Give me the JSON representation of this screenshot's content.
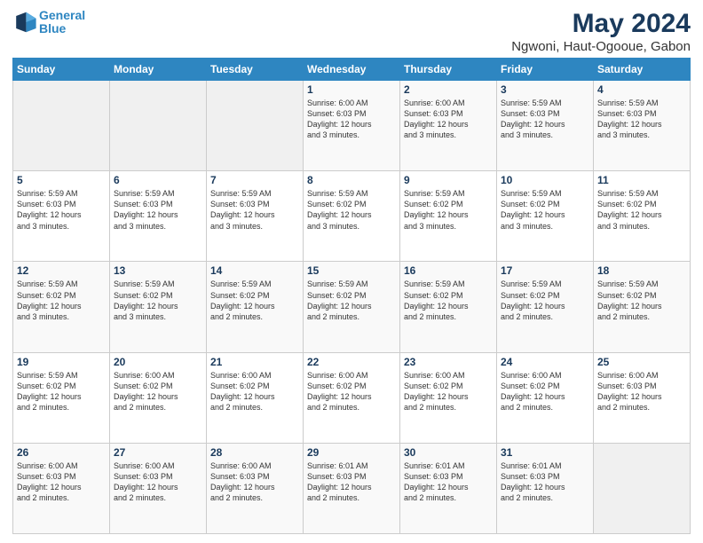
{
  "logo": {
    "line1": "General",
    "line2": "Blue"
  },
  "title": "May 2024",
  "subtitle": "Ngwoni, Haut-Ogooue, Gabon",
  "days_header": [
    "Sunday",
    "Monday",
    "Tuesday",
    "Wednesday",
    "Thursday",
    "Friday",
    "Saturday"
  ],
  "weeks": [
    [
      {
        "day": "",
        "info": ""
      },
      {
        "day": "",
        "info": ""
      },
      {
        "day": "",
        "info": ""
      },
      {
        "day": "1",
        "info": "Sunrise: 6:00 AM\nSunset: 6:03 PM\nDaylight: 12 hours\nand 3 minutes."
      },
      {
        "day": "2",
        "info": "Sunrise: 6:00 AM\nSunset: 6:03 PM\nDaylight: 12 hours\nand 3 minutes."
      },
      {
        "day": "3",
        "info": "Sunrise: 5:59 AM\nSunset: 6:03 PM\nDaylight: 12 hours\nand 3 minutes."
      },
      {
        "day": "4",
        "info": "Sunrise: 5:59 AM\nSunset: 6:03 PM\nDaylight: 12 hours\nand 3 minutes."
      }
    ],
    [
      {
        "day": "5",
        "info": "Sunrise: 5:59 AM\nSunset: 6:03 PM\nDaylight: 12 hours\nand 3 minutes."
      },
      {
        "day": "6",
        "info": "Sunrise: 5:59 AM\nSunset: 6:03 PM\nDaylight: 12 hours\nand 3 minutes."
      },
      {
        "day": "7",
        "info": "Sunrise: 5:59 AM\nSunset: 6:03 PM\nDaylight: 12 hours\nand 3 minutes."
      },
      {
        "day": "8",
        "info": "Sunrise: 5:59 AM\nSunset: 6:02 PM\nDaylight: 12 hours\nand 3 minutes."
      },
      {
        "day": "9",
        "info": "Sunrise: 5:59 AM\nSunset: 6:02 PM\nDaylight: 12 hours\nand 3 minutes."
      },
      {
        "day": "10",
        "info": "Sunrise: 5:59 AM\nSunset: 6:02 PM\nDaylight: 12 hours\nand 3 minutes."
      },
      {
        "day": "11",
        "info": "Sunrise: 5:59 AM\nSunset: 6:02 PM\nDaylight: 12 hours\nand 3 minutes."
      }
    ],
    [
      {
        "day": "12",
        "info": "Sunrise: 5:59 AM\nSunset: 6:02 PM\nDaylight: 12 hours\nand 3 minutes."
      },
      {
        "day": "13",
        "info": "Sunrise: 5:59 AM\nSunset: 6:02 PM\nDaylight: 12 hours\nand 3 minutes."
      },
      {
        "day": "14",
        "info": "Sunrise: 5:59 AM\nSunset: 6:02 PM\nDaylight: 12 hours\nand 2 minutes."
      },
      {
        "day": "15",
        "info": "Sunrise: 5:59 AM\nSunset: 6:02 PM\nDaylight: 12 hours\nand 2 minutes."
      },
      {
        "day": "16",
        "info": "Sunrise: 5:59 AM\nSunset: 6:02 PM\nDaylight: 12 hours\nand 2 minutes."
      },
      {
        "day": "17",
        "info": "Sunrise: 5:59 AM\nSunset: 6:02 PM\nDaylight: 12 hours\nand 2 minutes."
      },
      {
        "day": "18",
        "info": "Sunrise: 5:59 AM\nSunset: 6:02 PM\nDaylight: 12 hours\nand 2 minutes."
      }
    ],
    [
      {
        "day": "19",
        "info": "Sunrise: 5:59 AM\nSunset: 6:02 PM\nDaylight: 12 hours\nand 2 minutes."
      },
      {
        "day": "20",
        "info": "Sunrise: 6:00 AM\nSunset: 6:02 PM\nDaylight: 12 hours\nand 2 minutes."
      },
      {
        "day": "21",
        "info": "Sunrise: 6:00 AM\nSunset: 6:02 PM\nDaylight: 12 hours\nand 2 minutes."
      },
      {
        "day": "22",
        "info": "Sunrise: 6:00 AM\nSunset: 6:02 PM\nDaylight: 12 hours\nand 2 minutes."
      },
      {
        "day": "23",
        "info": "Sunrise: 6:00 AM\nSunset: 6:02 PM\nDaylight: 12 hours\nand 2 minutes."
      },
      {
        "day": "24",
        "info": "Sunrise: 6:00 AM\nSunset: 6:02 PM\nDaylight: 12 hours\nand 2 minutes."
      },
      {
        "day": "25",
        "info": "Sunrise: 6:00 AM\nSunset: 6:03 PM\nDaylight: 12 hours\nand 2 minutes."
      }
    ],
    [
      {
        "day": "26",
        "info": "Sunrise: 6:00 AM\nSunset: 6:03 PM\nDaylight: 12 hours\nand 2 minutes."
      },
      {
        "day": "27",
        "info": "Sunrise: 6:00 AM\nSunset: 6:03 PM\nDaylight: 12 hours\nand 2 minutes."
      },
      {
        "day": "28",
        "info": "Sunrise: 6:00 AM\nSunset: 6:03 PM\nDaylight: 12 hours\nand 2 minutes."
      },
      {
        "day": "29",
        "info": "Sunrise: 6:01 AM\nSunset: 6:03 PM\nDaylight: 12 hours\nand 2 minutes."
      },
      {
        "day": "30",
        "info": "Sunrise: 6:01 AM\nSunset: 6:03 PM\nDaylight: 12 hours\nand 2 minutes."
      },
      {
        "day": "31",
        "info": "Sunrise: 6:01 AM\nSunset: 6:03 PM\nDaylight: 12 hours\nand 2 minutes."
      },
      {
        "day": "",
        "info": ""
      }
    ]
  ]
}
